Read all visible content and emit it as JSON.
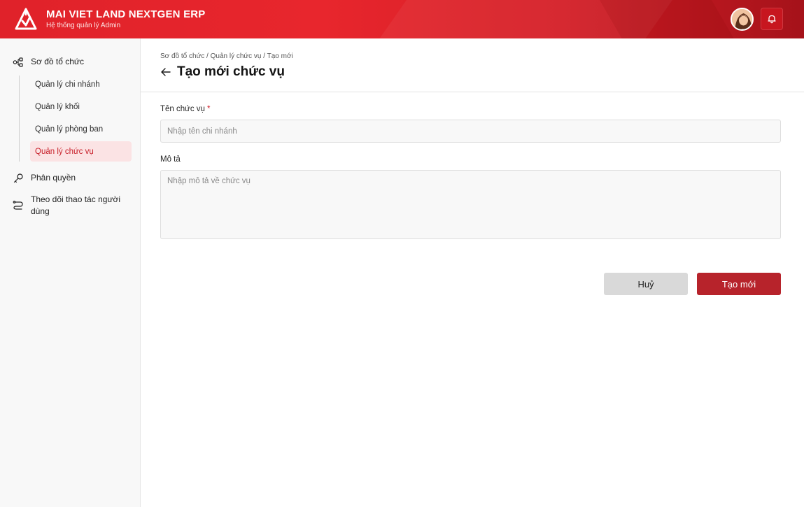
{
  "header": {
    "title": "MAI VIET LAND NEXTGEN ERP",
    "subtitle": "Hệ thống quản lý Admin",
    "logo_icon": "mvl-triangle-logo-icon",
    "avatar_icon": "user-avatar",
    "notification_icon": "bell-icon",
    "brand_color": "#e0222a"
  },
  "sidebar": {
    "groups": [
      {
        "label": "Sơ đồ tổ chức",
        "icon": "org-chart-icon"
      },
      {
        "label": "Phân quyền",
        "icon": "key-icon"
      },
      {
        "label": "Theo dõi thao tác người dùng",
        "icon": "route-icon"
      }
    ],
    "sub_items": [
      {
        "label": "Quản lý chi nhánh",
        "active": false
      },
      {
        "label": "Quản lý khối",
        "active": false
      },
      {
        "label": "Quản lý phòng ban",
        "active": false
      },
      {
        "label": "Quản lý chức vụ",
        "active": true
      }
    ],
    "active_color": "#c8202a"
  },
  "main": {
    "breadcrumb": "Sơ đồ tổ chức / Quản lý chức vụ / Tạo mới",
    "title": "Tạo mới chức vụ",
    "back_icon": "arrow-left-icon",
    "form": {
      "name_label": "Tên chức vụ",
      "required_mark": "*",
      "name_value": "",
      "name_placeholder": "Nhập tên chi nhánh",
      "desc_label": "Mô tả",
      "desc_value": "",
      "desc_placeholder": "Nhập mô tả về chức vụ"
    },
    "actions": {
      "cancel_label": "Huỷ",
      "create_label": "Tạo mới",
      "create_color": "#b7232b"
    }
  }
}
